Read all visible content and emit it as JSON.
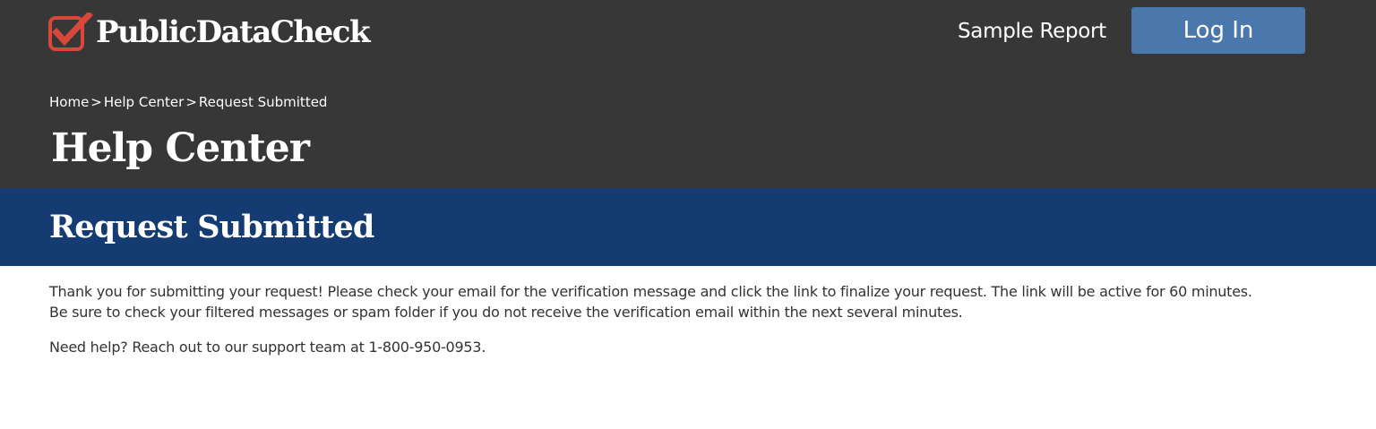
{
  "header": {
    "logo_text": "PublicDataCheck",
    "logo_icon": "checkmark-box-icon",
    "nav_sample_report": "Sample Report",
    "login_label": "Log In"
  },
  "breadcrumb": {
    "items": [
      "Home",
      "Help Center",
      "Request Submitted"
    ],
    "separator": ">"
  },
  "page_title": "Help Center",
  "section_title": "Request Submitted",
  "content": {
    "message_line1": "Thank you for submitting your request! Please check your email for the verification message and click the link to finalize your request. The link will be active for 60 minutes.",
    "message_line2": "Be sure to check your filtered messages or spam folder if you do not receive the verification email within the next several minutes.",
    "help_text": "Need help? Reach out to our support team at 1-800-950-0953."
  },
  "colors": {
    "header_bg": "#373737",
    "section_bg": "#143c72",
    "button_bg": "#4a78ac",
    "logo_accent": "#d9473a"
  }
}
